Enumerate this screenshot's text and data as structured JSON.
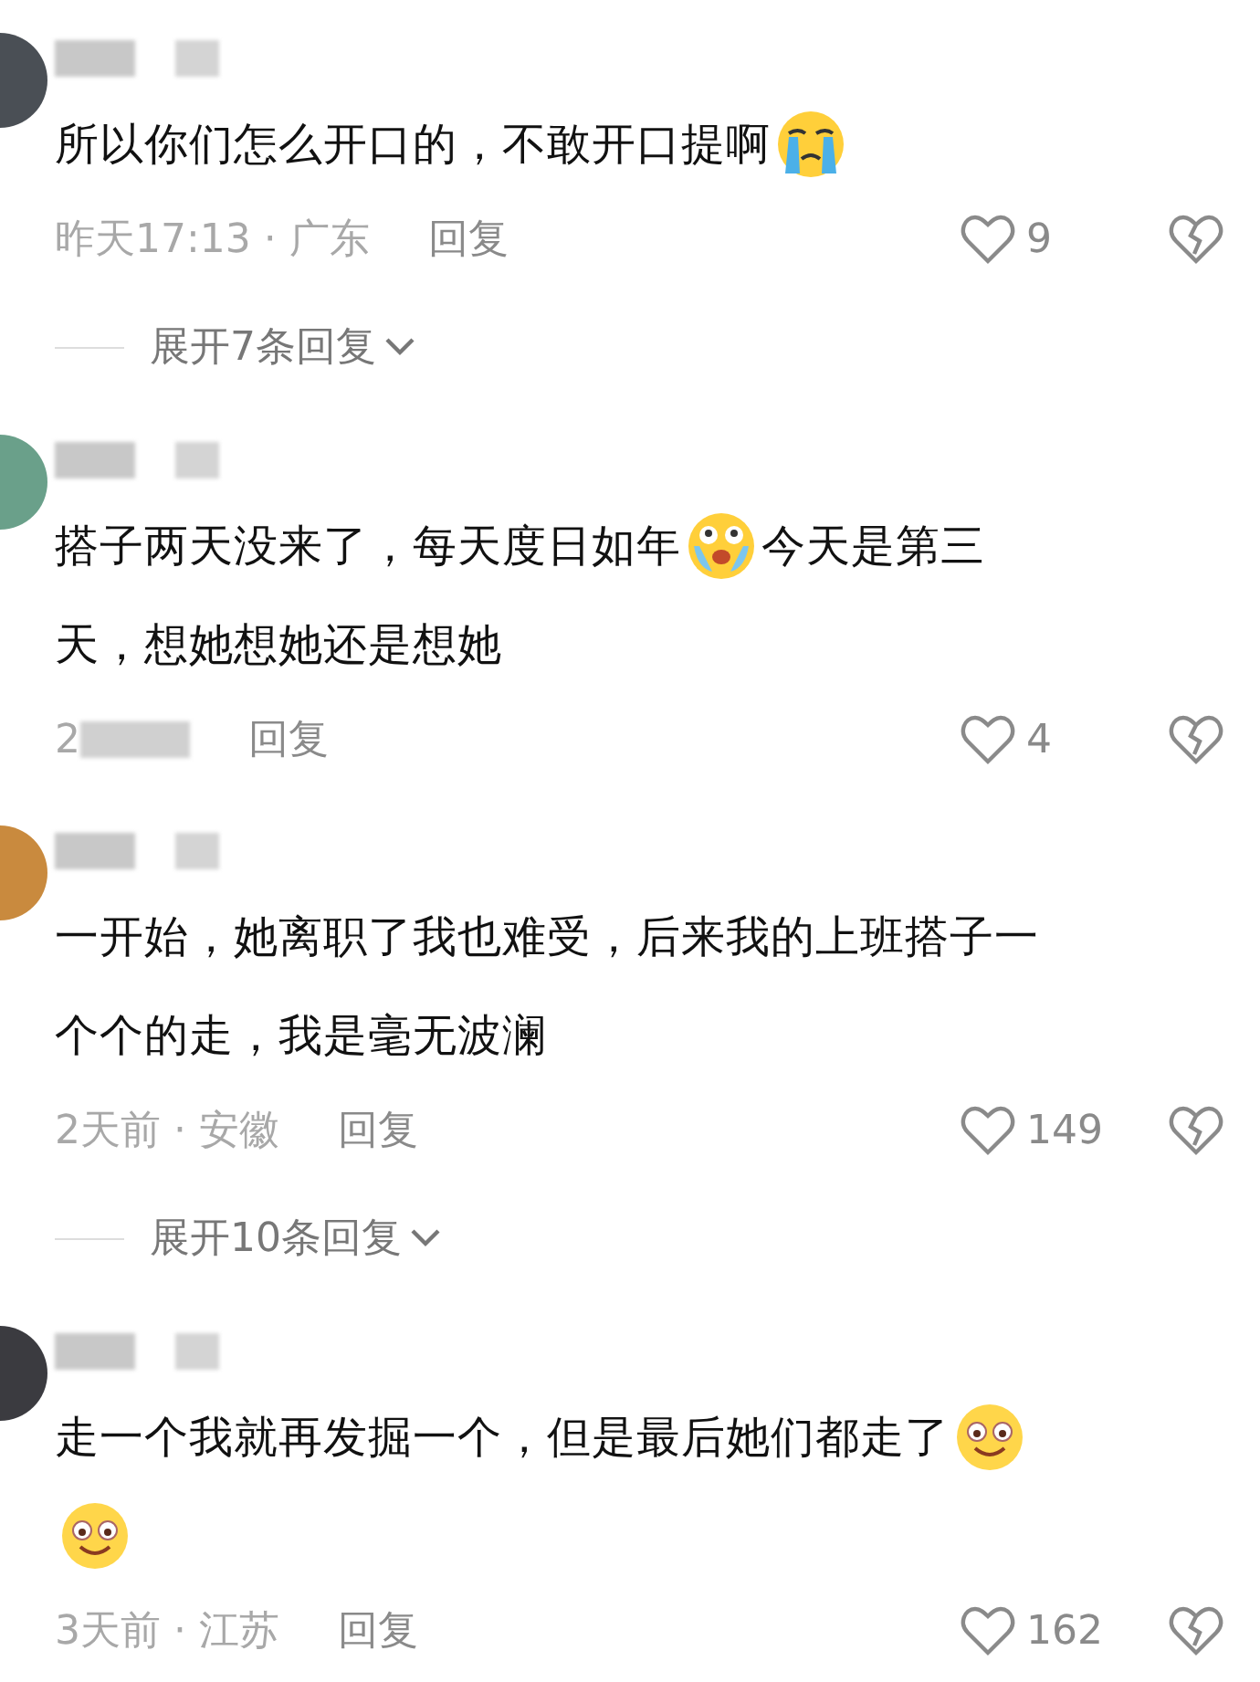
{
  "comments": [
    {
      "lines": [
        [
          {
            "kind": "text",
            "text": "所以你们怎么开口的，不敢开口提啊"
          },
          {
            "kind": "crying_emoji"
          }
        ]
      ],
      "meta": "昨天17:13 · 广东",
      "meta_blurred": false,
      "reply": "回复",
      "likes": "9",
      "expand": "展开7条回复"
    },
    {
      "lines": [
        [
          {
            "kind": "text",
            "text": "搭子两天没来了，每天度日如年"
          },
          {
            "kind": "teary_emoji"
          },
          {
            "kind": "text",
            "text": "今天是第三"
          }
        ],
        [
          {
            "kind": "text",
            "text": "天，想她想她还是想她"
          }
        ]
      ],
      "meta": "2",
      "meta_blurred": true,
      "reply": "回复",
      "likes": "4"
    },
    {
      "lines": [
        [
          {
            "kind": "text",
            "text": "一开始，她离职了我也难受，后来我的上班搭子一"
          }
        ],
        [
          {
            "kind": "text",
            "text": "个个的走，我是毫无波澜"
          }
        ]
      ],
      "meta": "2天前 · 安徽",
      "meta_blurred": false,
      "reply": "回复",
      "likes": "149",
      "expand": "展开10条回复"
    },
    {
      "lines": [
        [
          {
            "kind": "text",
            "text": "走一个我就再发掘一个，但是最后她们都走了"
          },
          {
            "kind": "smile_emoji"
          }
        ],
        [
          {
            "kind": "smile_emoji"
          }
        ]
      ],
      "meta": "3天前 · 江苏",
      "meta_blurred": false,
      "reply": "回复",
      "likes": "162"
    }
  ]
}
